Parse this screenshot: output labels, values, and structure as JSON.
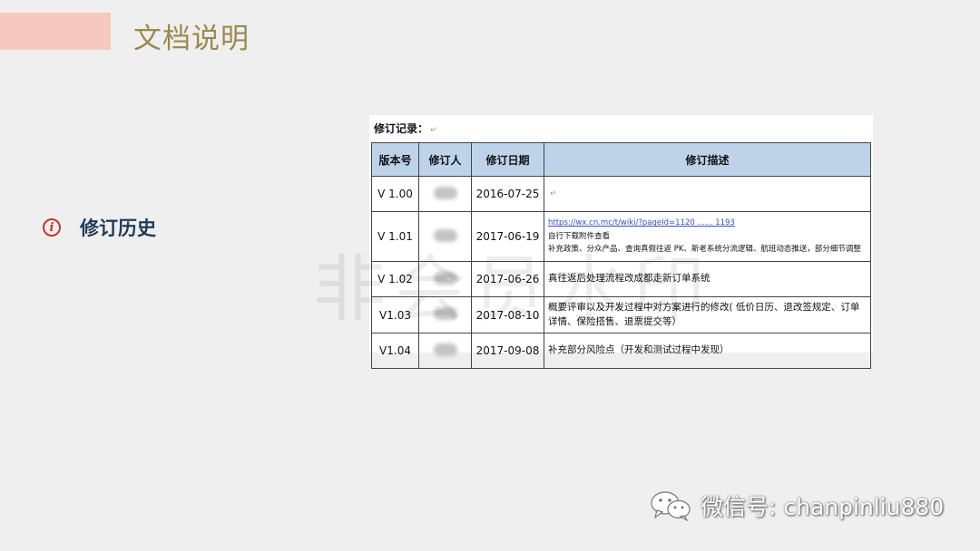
{
  "header": {
    "title": "文档说明"
  },
  "section": {
    "label": "修订历史"
  },
  "watermark": "非会员水印",
  "document": {
    "heading": "修订记录：",
    "para_mark": "↵",
    "columns": [
      "版本号",
      "修订人",
      "修订日期",
      "修订描述"
    ],
    "rows": [
      {
        "version": "V 1.00",
        "date": "2016-07-25",
        "desc_lines": [
          ""
        ]
      },
      {
        "version": "V 1.01",
        "date": "2017-06-19",
        "link": "https://wx.cn.mc/t/wiki/?pageId=1120 …… 1193",
        "desc_lines": [
          "自行下载附件查看",
          "补充政策、分众产品、查询真假往返 PK、新老系统分流逻辑、航班动态推送，部分细节调整"
        ]
      },
      {
        "version": "V 1.02",
        "date": "2017-06-26",
        "desc_lines": [
          "真往返后处理流程改成都走新订单系统"
        ]
      },
      {
        "version": "V1.03",
        "date": "2017-08-10",
        "desc_lines": [
          "概要评审以及开发过程中对方案进行的修改( 低价日历、退改签规定、订单详情、保险搭售、退票提交等）"
        ]
      },
      {
        "version": "V1.04",
        "date": "2017-09-08",
        "desc_lines": [
          "补充部分风险点（开发和测试过程中发现）"
        ]
      }
    ]
  },
  "footer": {
    "text": "微信号: chanpinliu880"
  },
  "colors": {
    "accent_bar": "#f7c8c0",
    "title": "#9a8a4c",
    "section_label": "#1f3b57",
    "info_icon": "#c0392b",
    "table_header": "#bdd3ea"
  }
}
